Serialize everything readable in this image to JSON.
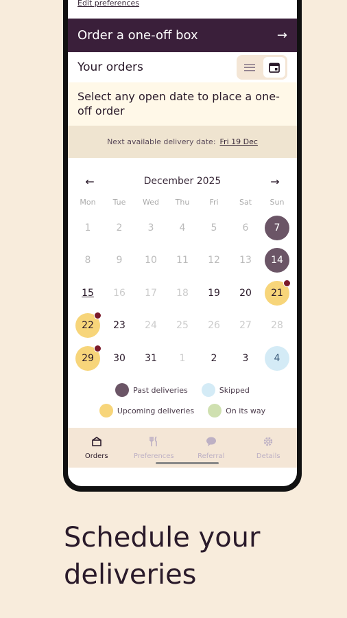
{
  "edit_preferences": "Edit preferences",
  "oneoff": {
    "label": "Order a one-off box",
    "arrow": "→"
  },
  "orders": {
    "title": "Your orders"
  },
  "hint": "Select any open date to place a one-off order",
  "next_delivery": {
    "label": "Next available delivery date:",
    "date": "Fri 19 Dec"
  },
  "calendar": {
    "month": "December 2025",
    "prev": "←",
    "next": "→",
    "weekdays": [
      "Mon",
      "Tue",
      "Wed",
      "Thu",
      "Fri",
      "Sat",
      "Sun"
    ],
    "days": [
      {
        "d": "1",
        "s": "past"
      },
      {
        "d": "2",
        "s": "past"
      },
      {
        "d": "3",
        "s": "past"
      },
      {
        "d": "4",
        "s": "past"
      },
      {
        "d": "5",
        "s": "past"
      },
      {
        "d": "6",
        "s": "past"
      },
      {
        "d": "7",
        "s": "pastdel"
      },
      {
        "d": "8",
        "s": "past"
      },
      {
        "d": "9",
        "s": "past"
      },
      {
        "d": "10",
        "s": "past"
      },
      {
        "d": "11",
        "s": "past"
      },
      {
        "d": "12",
        "s": "past"
      },
      {
        "d": "13",
        "s": "past"
      },
      {
        "d": "14",
        "s": "pastdel"
      },
      {
        "d": "15",
        "s": "next"
      },
      {
        "d": "16",
        "s": "dim"
      },
      {
        "d": "17",
        "s": "dim"
      },
      {
        "d": "18",
        "s": "dim"
      },
      {
        "d": "19",
        "s": "open"
      },
      {
        "d": "20",
        "s": "open"
      },
      {
        "d": "21",
        "s": "upcoming",
        "dot": true
      },
      {
        "d": "22",
        "s": "upcoming",
        "dot": true
      },
      {
        "d": "23",
        "s": "open"
      },
      {
        "d": "24",
        "s": "dim"
      },
      {
        "d": "25",
        "s": "dim"
      },
      {
        "d": "26",
        "s": "dim"
      },
      {
        "d": "27",
        "s": "dim"
      },
      {
        "d": "28",
        "s": "dim"
      },
      {
        "d": "29",
        "s": "upcoming",
        "dot": true
      },
      {
        "d": "30",
        "s": "open"
      },
      {
        "d": "31",
        "s": "open"
      },
      {
        "d": "1",
        "s": "other"
      },
      {
        "d": "2",
        "s": "open"
      },
      {
        "d": "3",
        "s": "open"
      },
      {
        "d": "4",
        "s": "skipped"
      }
    ]
  },
  "legend": [
    [
      {
        "label": "Past deliveries",
        "color": "#6b5566"
      },
      {
        "label": "Skipped",
        "color": "#d4ebf6"
      }
    ],
    [
      {
        "label": "Upcoming deliveries",
        "color": "#f7d57a"
      },
      {
        "label": "On its way",
        "color": "#cfe0b0"
      }
    ]
  ],
  "tabs": [
    {
      "label": "Orders",
      "icon": "box-icon",
      "active": true
    },
    {
      "label": "Preferences",
      "icon": "cutlery-icon",
      "active": false
    },
    {
      "label": "Referral",
      "icon": "chat-bubble-icon",
      "active": false
    },
    {
      "label": "Details",
      "icon": "gear-icon",
      "active": false
    }
  ],
  "headline": "Schedule your deliveries"
}
